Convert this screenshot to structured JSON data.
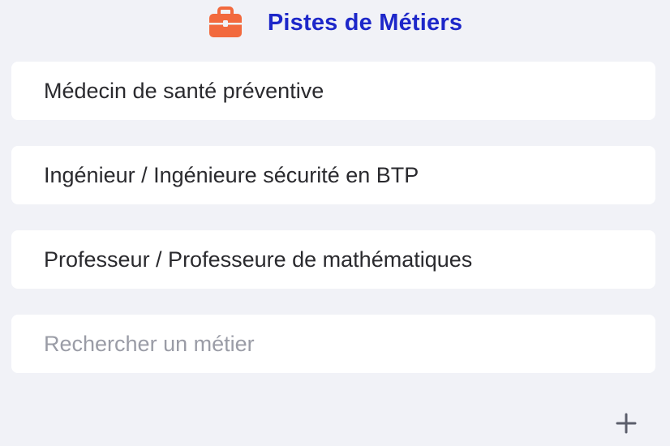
{
  "header": {
    "title": "Pistes de Métiers",
    "icon": "briefcase-icon",
    "icon_color": "#f2693d",
    "title_color": "#1d27c9"
  },
  "jobs": [
    {
      "label": "Médecin de santé préventive"
    },
    {
      "label": "Ingénieur / Ingénieure sécurité en BTP"
    },
    {
      "label": "Professeur / Professeure de mathématiques"
    }
  ],
  "search": {
    "value": "",
    "placeholder": "Rechercher un métier"
  },
  "add_button": {
    "icon": "plus-icon"
  }
}
